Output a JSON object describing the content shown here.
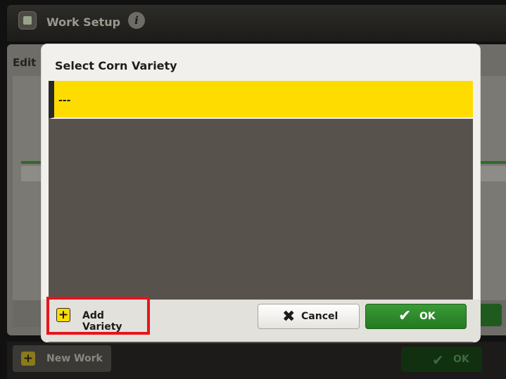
{
  "app": {
    "title": "Work Setup",
    "tab_label": "Edit",
    "logo_icon": "work-setup-icon",
    "info_icon": "info-icon",
    "info_glyph": "i"
  },
  "bottom_bar": {
    "new_work_label": "New Work",
    "ok_label": "OK"
  },
  "dialog": {
    "title": "Select Corn Variety",
    "items": [
      {
        "label": "---",
        "selected": true
      }
    ],
    "buttons": {
      "add_variety_label": "Add Variety",
      "cancel_label": "Cancel",
      "ok_label": "OK"
    },
    "glyphs": {
      "plus": "+",
      "cancel": "✖",
      "check": "✔"
    }
  },
  "colors": {
    "selection": "#ffdc00",
    "ok_green": "#2d8a2a",
    "highlight_border": "#e8141c"
  }
}
